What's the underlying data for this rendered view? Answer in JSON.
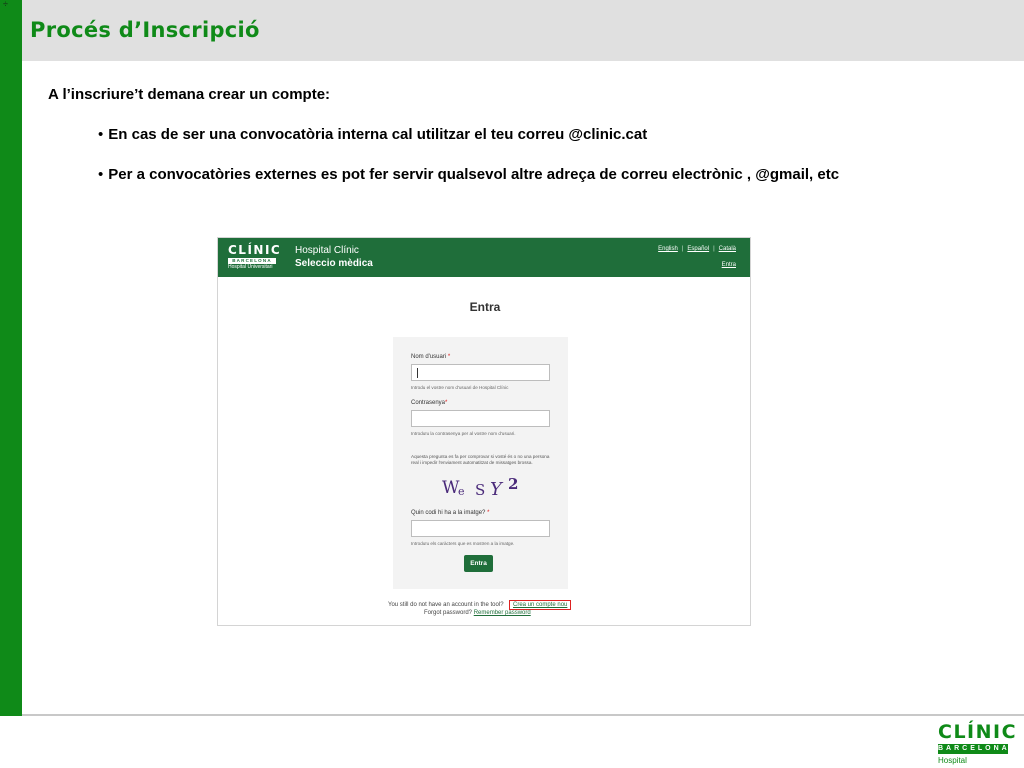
{
  "slide": {
    "corner_mark": "÷",
    "title": "Procés d’Inscripció",
    "intro": "A l’inscriure’t demana crear un compte:",
    "bullets": [
      "En cas de ser una convocatòria interna  cal  utilitzar el teu correu @clinic.cat",
      "Per a convocatòries externes es pot fer servir qualsevol altre adreça de correu electrònic , @gmail,  etc"
    ],
    "bullet_symbol": "•"
  },
  "screenshot": {
    "logo": {
      "name": "CLÍNIC",
      "sub": "BARCELONA",
      "sub2": "Hospital Universitari"
    },
    "header_title": "Hospital Clínic",
    "header_subtitle": "Seleccio mèdica",
    "languages": [
      "English",
      "Español",
      "Català"
    ],
    "header_login": "Entra",
    "heading": "Entra",
    "username_label": "Nom d'usuari",
    "username_help": "Introdu el vostre nom d'usuari de Hospital Clínic",
    "password_label": "Contrasenya",
    "password_help": "Introduïu la contrasenya per al vostre nom d'usuari.",
    "required_mark": "*",
    "captcha_note": "Aquesta pregunta es fa per comprovar si vosté és o no una persona real i impedir l'enviament automatitzat de missatges brossa.",
    "captcha_chars": [
      "W",
      "e",
      "S",
      "Y",
      "2"
    ],
    "captcha_label": "Quin codi hi ha a la imatge?",
    "captcha_help": "Introduïu els caràcters que es mostren a la imatge.",
    "submit": "Entra",
    "account_text": "You still do not have an account in the tool?",
    "create_account": "Crea un compte nou",
    "forgot_text": "Forgot password?",
    "forgot_link": "Remember password"
  },
  "footer_logo": {
    "name": "CLÍNIC",
    "sub": "BARCELONA",
    "sub2": "Hospital Universitari"
  },
  "colors": {
    "accent": "#0f8a18",
    "header_green": "#1f6e3a",
    "highlight": "#dd2222"
  }
}
